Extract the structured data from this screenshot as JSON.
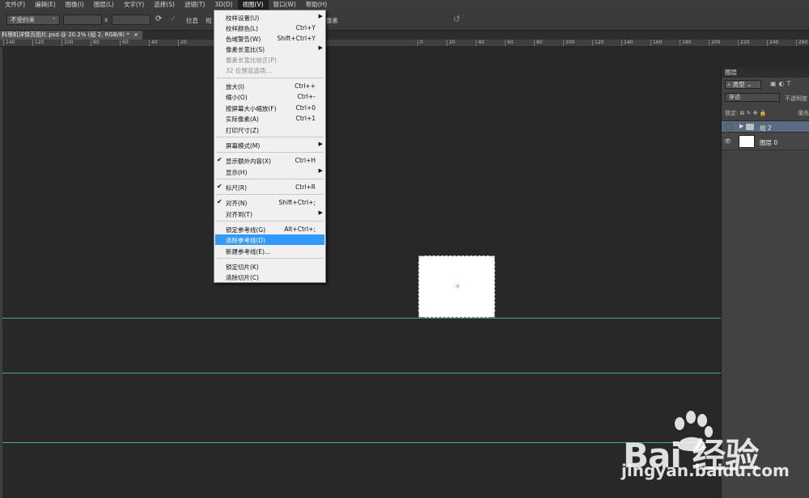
{
  "menubar": {
    "items": [
      "文件(F)",
      "编辑(E)",
      "图像(I)",
      "图层(L)",
      "文字(Y)",
      "选择(S)",
      "滤镜(T)",
      "3D(D)",
      "视图(V)",
      "窗口(W)",
      "帮助(H)"
    ]
  },
  "options_bar": {
    "constraint": "不受约束",
    "x_label": "x",
    "straighten": "拉直",
    "view_label": "视",
    "pixels_label": "像素"
  },
  "document_tab": {
    "title": "料理机详情页图片.psd @ 20.2% (组 2, RGB/8) *"
  },
  "ruler": {
    "ticks": [
      "140",
      "120",
      "100",
      "80",
      "60",
      "40",
      "20",
      "0",
      "20",
      "40",
      "60",
      "80",
      "100",
      "120",
      "140",
      "160",
      "180",
      "200",
      "220",
      "240",
      "260",
      "280"
    ]
  },
  "view_menu": {
    "items": [
      {
        "label": "校样设置(U)",
        "shortcut": "",
        "submenu": true,
        "checked": false,
        "disabled": false,
        "highlighted": false
      },
      {
        "label": "校样颜色(L)",
        "shortcut": "Ctrl+Y",
        "submenu": false,
        "checked": false,
        "disabled": false,
        "highlighted": false
      },
      {
        "label": "色域警告(W)",
        "shortcut": "Shift+Ctrl+Y",
        "submenu": false,
        "checked": false,
        "disabled": false,
        "highlighted": false
      },
      {
        "label": "像素长宽比(S)",
        "shortcut": "",
        "submenu": true,
        "checked": false,
        "disabled": false,
        "highlighted": false
      },
      {
        "label": "像素长宽比校正(P)",
        "shortcut": "",
        "submenu": false,
        "checked": false,
        "disabled": true,
        "highlighted": false
      },
      {
        "label": "32 位预览选项...",
        "shortcut": "",
        "submenu": false,
        "checked": false,
        "disabled": true,
        "highlighted": false
      },
      {
        "label": "放大(I)",
        "shortcut": "Ctrl++",
        "submenu": false,
        "checked": false,
        "disabled": false,
        "highlighted": false
      },
      {
        "label": "缩小(O)",
        "shortcut": "Ctrl+-",
        "submenu": false,
        "checked": false,
        "disabled": false,
        "highlighted": false
      },
      {
        "label": "按屏幕大小缩放(F)",
        "shortcut": "Ctrl+0",
        "submenu": false,
        "checked": false,
        "disabled": false,
        "highlighted": false
      },
      {
        "label": "实际像素(A)",
        "shortcut": "Ctrl+1",
        "submenu": false,
        "checked": false,
        "disabled": false,
        "highlighted": false
      },
      {
        "label": "打印尺寸(Z)",
        "shortcut": "",
        "submenu": false,
        "checked": false,
        "disabled": false,
        "highlighted": false
      },
      {
        "label": "屏幕模式(M)",
        "shortcut": "",
        "submenu": true,
        "checked": false,
        "disabled": false,
        "highlighted": false
      },
      {
        "label": "显示额外内容(X)",
        "shortcut": "Ctrl+H",
        "submenu": false,
        "checked": true,
        "disabled": false,
        "highlighted": false
      },
      {
        "label": "显示(H)",
        "shortcut": "",
        "submenu": true,
        "checked": false,
        "disabled": false,
        "highlighted": false
      },
      {
        "label": "标尺(R)",
        "shortcut": "Ctrl+R",
        "submenu": false,
        "checked": true,
        "disabled": false,
        "highlighted": false
      },
      {
        "label": "对齐(N)",
        "shortcut": "Shift+Ctrl+;",
        "submenu": false,
        "checked": true,
        "disabled": false,
        "highlighted": false
      },
      {
        "label": "对齐到(T)",
        "shortcut": "",
        "submenu": true,
        "checked": false,
        "disabled": false,
        "highlighted": false
      },
      {
        "label": "锁定参考线(G)",
        "shortcut": "Alt+Ctrl+;",
        "submenu": false,
        "checked": false,
        "disabled": false,
        "highlighted": false
      },
      {
        "label": "清除参考线(D)",
        "shortcut": "",
        "submenu": false,
        "checked": false,
        "disabled": false,
        "highlighted": true
      },
      {
        "label": "新建参考线(E)...",
        "shortcut": "",
        "submenu": false,
        "checked": false,
        "disabled": false,
        "highlighted": false
      },
      {
        "label": "锁定切片(K)",
        "shortcut": "",
        "submenu": false,
        "checked": false,
        "disabled": false,
        "highlighted": false
      },
      {
        "label": "清除切片(C)",
        "shortcut": "",
        "submenu": false,
        "checked": false,
        "disabled": false,
        "highlighted": false
      }
    ]
  },
  "layers_panel": {
    "title": "图层",
    "filter": "类型",
    "blend_mode": "穿透",
    "opacity_label": "不透明度",
    "lock_label": "锁定:",
    "fill_label": "填充",
    "layers": [
      {
        "name": "组 2",
        "type": "group",
        "selected": true
      },
      {
        "name": "图层 0",
        "type": "layer",
        "selected": false
      }
    ]
  },
  "watermark": {
    "logo": "Bai  经验",
    "url": "jingyan.baidu.com"
  },
  "colors": {
    "menu_highlight": "#3399ff",
    "guide": "#4aa3a3",
    "canvas_bg": "#282828"
  }
}
